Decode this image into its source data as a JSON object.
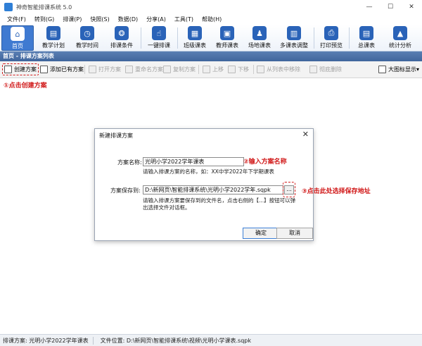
{
  "window": {
    "title": "神奇智能排课系统 5.0",
    "minimize": "—",
    "maximize": "☐",
    "close": "✕"
  },
  "menu": [
    "文件(F)",
    "转到(G)",
    "排课(P)",
    "快照(S)",
    "数据(D)",
    "分享(A)",
    "工具(T)",
    "帮助(H)"
  ],
  "toolbar": {
    "items": [
      {
        "label": "首页",
        "icon": "home-icon",
        "glyph": "⌂"
      },
      {
        "label": "教学计划",
        "icon": "briefcase-icon",
        "glyph": "▤"
      },
      {
        "label": "教学时间",
        "icon": "clock-icon",
        "glyph": "◷"
      },
      {
        "label": "排课条件",
        "icon": "conditions-icon",
        "glyph": "❂"
      },
      {
        "label": "一键排课",
        "icon": "pointer-icon",
        "glyph": "☝"
      },
      {
        "label": "班级课表",
        "icon": "class-timetable-icon",
        "glyph": "▦"
      },
      {
        "label": "教师课表",
        "icon": "teacher-timetable-icon",
        "glyph": "▣"
      },
      {
        "label": "场地课表",
        "icon": "venue-timetable-icon",
        "glyph": "♟"
      },
      {
        "label": "多课表调整",
        "icon": "multi-timetable-icon",
        "glyph": "▥"
      },
      {
        "label": "打印预览",
        "icon": "print-icon",
        "glyph": "⎙"
      },
      {
        "label": "总课表",
        "icon": "master-timetable-icon",
        "glyph": "▤"
      },
      {
        "label": "统计分析",
        "icon": "chart-icon",
        "glyph": "▲"
      }
    ]
  },
  "panel": {
    "title": "首页 - 排课方案列表"
  },
  "actions": {
    "create": "创建方案",
    "add_existing": "添加已有方案",
    "open": "打开方案",
    "rename": "重命名方案",
    "copy": "复制方案",
    "move_up": "上移",
    "move_down": "下移",
    "remove_from_list": "从列表中移除",
    "delete": "彻底删除",
    "view_mode": "大图标显示",
    "view_mode_arrow": "▾"
  },
  "annotations": {
    "step1": "①点击创建方案",
    "step2": "②输入方案名称",
    "step3": "③点击此处选择保存地址"
  },
  "dialog": {
    "title": "新建排课方案",
    "close": "✕",
    "name_label": "方案名称:",
    "name_value": "光明小学2022学年课表",
    "name_hint": "请输入排课方案的名称，如：XX中学2022年下学期课表",
    "path_label": "方案保存到:",
    "path_value": "D:\\新网页\\智能排课系统\\光明小学2022学年.sqpk",
    "browse": "...",
    "path_hint_1": "请输入排课方案要保存到的文件名，点击右侧的【...】按钮可以弹",
    "path_hint_2": "出选择文件对话框。",
    "ok": "确定",
    "cancel": "取消"
  },
  "status": {
    "plan": "排课方案:  光明小学2022学年课表",
    "file": "文件位置:  D:\\新网页\\智能排课系统\\视频\\光明小学课表.sqpk"
  }
}
